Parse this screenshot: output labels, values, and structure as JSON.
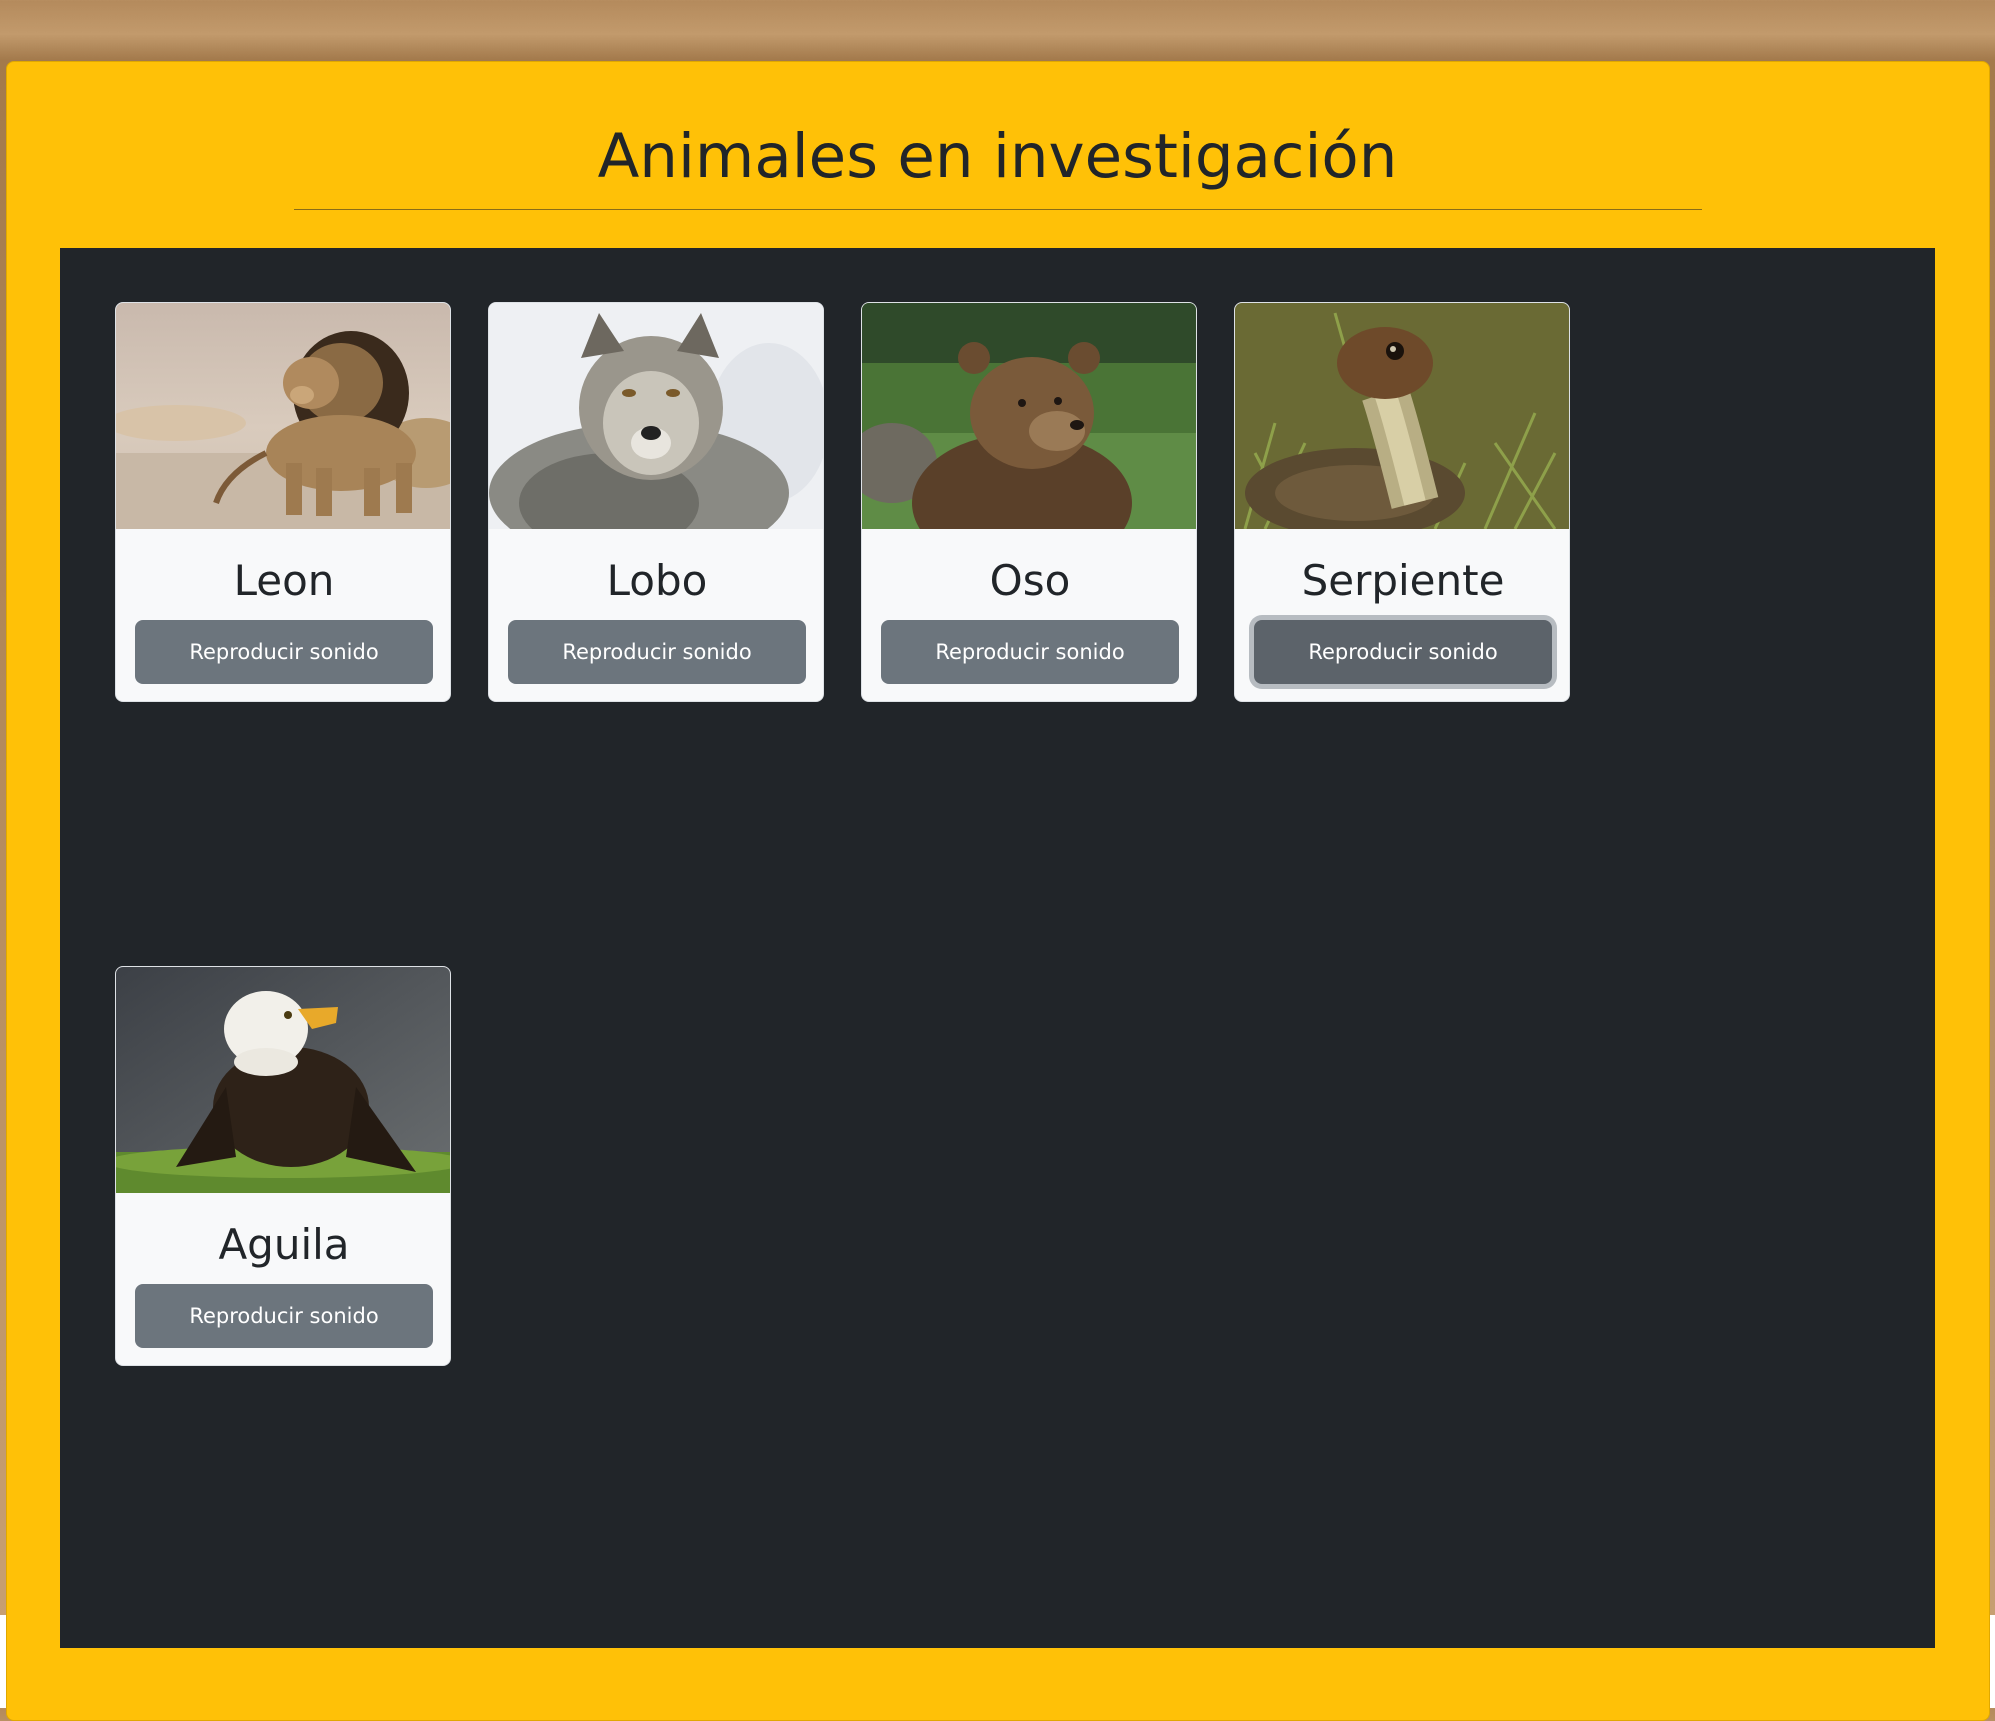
{
  "page": {
    "title": "Animales en investigación"
  },
  "colors": {
    "panel": "#ffc107",
    "stage": "#212529",
    "card": "#f8f9fa",
    "button": "#6c757d",
    "text": "#212529"
  },
  "animals": [
    {
      "name": "Leon",
      "button_label": "Reproducir sonido",
      "image": "lion-photo"
    },
    {
      "name": "Lobo",
      "button_label": "Reproducir sonido",
      "image": "wolf-photo"
    },
    {
      "name": "Oso",
      "button_label": "Reproducir sonido",
      "image": "bear-photo"
    },
    {
      "name": "Serpiente",
      "button_label": "Reproducir sonido",
      "image": "snake-photo",
      "focused": true
    },
    {
      "name": "Aguila",
      "button_label": "Reproducir sonido",
      "image": "eagle-photo"
    }
  ]
}
